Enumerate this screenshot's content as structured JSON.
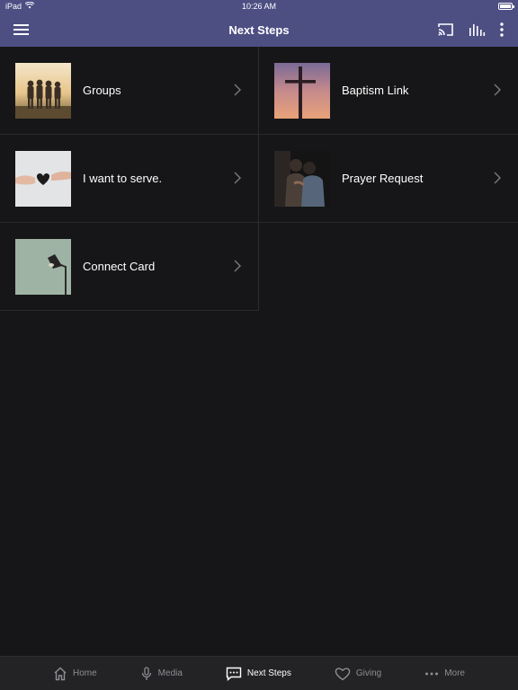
{
  "status": {
    "device": "iPad",
    "time": "10:26 AM"
  },
  "nav": {
    "title": "Next Steps",
    "icons": [
      "menu-icon",
      "cast-icon",
      "audio-bars-icon",
      "more-vertical-icon"
    ]
  },
  "items": [
    {
      "label": "Groups",
      "image": "friends-sunset-photo"
    },
    {
      "label": "Baptism Link",
      "image": "cross-sunset-photo"
    },
    {
      "label": "I want to serve.",
      "image": "hands-heart-photo"
    },
    {
      "label": "Prayer Request",
      "image": "men-praying-photo"
    },
    {
      "label": "Connect Card",
      "image": "desk-lamp-photo"
    }
  ],
  "tabs": [
    {
      "label": "Home",
      "icon": "home-icon",
      "active": false
    },
    {
      "label": "Media",
      "icon": "microphone-icon",
      "active": false
    },
    {
      "label": "Next Steps",
      "icon": "chat-bubble-icon",
      "active": true
    },
    {
      "label": "Giving",
      "icon": "heart-icon",
      "active": false
    },
    {
      "label": "More",
      "icon": "ellipsis-icon",
      "active": false
    }
  ],
  "colors": {
    "navbar": "#4d4f83",
    "background": "#161618",
    "tabbar": "#232326",
    "inactive_tab": "#8e8e93"
  }
}
